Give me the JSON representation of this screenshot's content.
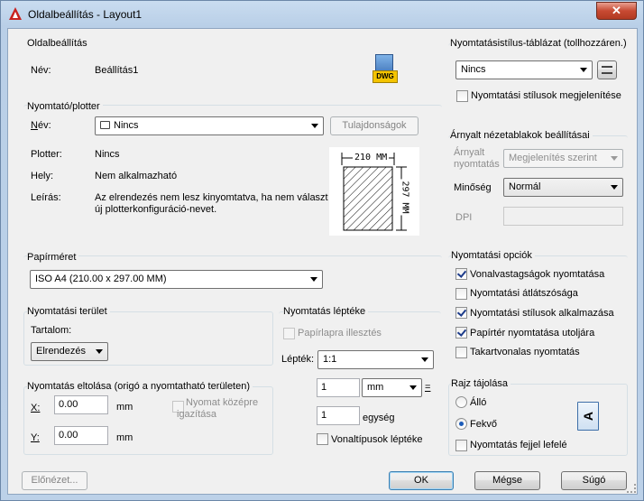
{
  "window": {
    "title": "Oldalbeállítás - Layout1",
    "close_glyph": "✕"
  },
  "page_setup": {
    "group": "Oldalbeállítás",
    "name_label": "Név:",
    "name_value": "Beállítás1",
    "dwg_badge": "DWG"
  },
  "printer": {
    "group": "Nyomtató/plotter",
    "name_label": "Név:",
    "name_value": "Nincs",
    "properties_button": "Tulajdonságok",
    "plotter_label": "Plotter:",
    "plotter_value": "Nincs",
    "where_label": "Hely:",
    "where_value": "Nem alkalmazható",
    "desc_label": "Leírás:",
    "desc_line1": "Az elrendezés nem lesz kinyomtatva, ha nem választ",
    "desc_line2": "új plotterkonfiguráció-nevet.",
    "preview_width": "210 MM",
    "preview_height": "297 MM"
  },
  "paper_size": {
    "group": "Papírméret",
    "value": "ISO A4 (210.00 x 297.00 MM)"
  },
  "plot_area": {
    "group": "Nyomtatási terület",
    "what_label": "Tartalom:",
    "what_value": "Elrendezés"
  },
  "plot_offset": {
    "group": "Nyomtatás eltolása (origó a nyomtatható területen)",
    "x_label": "X:",
    "x_value": "0.00",
    "x_unit": "mm",
    "y_label": "Y:",
    "y_value": "0.00",
    "y_unit": "mm",
    "center_label_1": "Nyomat középre",
    "center_label_2": "igazítása"
  },
  "plot_scale": {
    "group": "Nyomtatás léptéke",
    "fit_label": "Papírlapra illesztés",
    "scale_label": "Lépték:",
    "scale_value": "1:1",
    "num_value": "1",
    "unit_value": "mm",
    "equals": "=",
    "den_value": "1",
    "den_unit": "egység",
    "lineweights_label": "Vonaltípusok léptéke"
  },
  "plot_style": {
    "group": "Nyomtatásistílus-táblázat (tollhozzáren.)",
    "value": "Nincs",
    "display_label": "Nyomtatási stílusok megjelenítése"
  },
  "shaded": {
    "group": "Árnyalt nézetablakok beállításai",
    "shade_label_1": "Árnyalt",
    "shade_label_2": "nyomtatás",
    "shade_value": "Megjelenítés szerint",
    "quality_label": "Minőség",
    "quality_value": "Normál",
    "dpi_label": "DPI",
    "dpi_value": ""
  },
  "plot_options": {
    "group": "Nyomtatási opciók",
    "items": [
      {
        "label": "Vonalvastagságok nyomtatása",
        "checked": true
      },
      {
        "label": "Nyomtatási átlátszósága",
        "checked": false
      },
      {
        "label": "Nyomtatási stílusok alkalmazása",
        "checked": true
      },
      {
        "label": "Papírtér nyomtatása utoljára",
        "checked": true
      },
      {
        "label": "Takartvonalas nyomtatás",
        "checked": false
      }
    ]
  },
  "orientation": {
    "group": "Rajz tájolása",
    "portrait_label": "Álló",
    "landscape_label": "Fekvő",
    "upside_down_label": "Nyomtatás fejjel lefelé",
    "selected": "Fekvő",
    "paper_glyph": "A"
  },
  "footer": {
    "preview_button": "Előnézet...",
    "ok_button": "OK",
    "cancel_button": "Mégse",
    "help_button": "Súgó"
  }
}
